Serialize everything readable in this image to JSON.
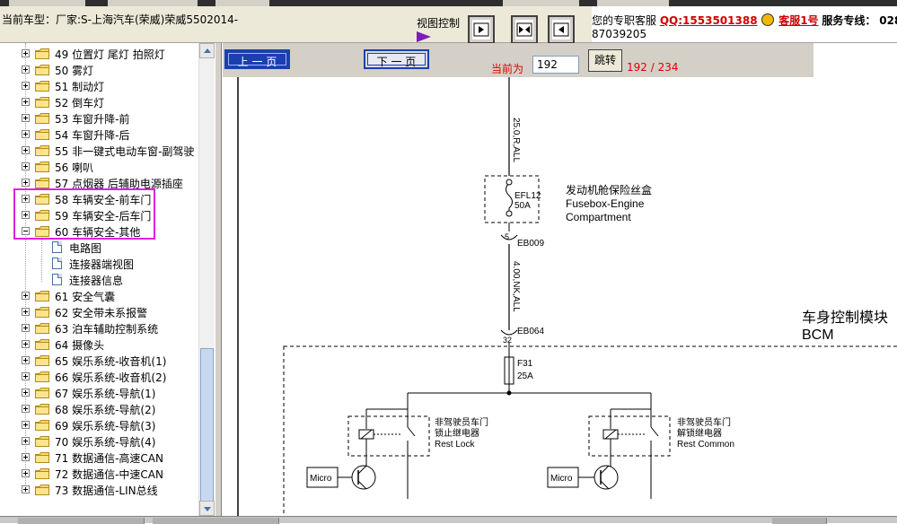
{
  "header": {
    "car_type": "当前车型：厂家:S-上海汽车(荣威)荣威5502014-",
    "view_control": "视图控制"
  },
  "service": {
    "prefix": "您的专职客服",
    "qq": "QQ:1553501388",
    "kefu": "客服1号",
    "hotline_label": "服务专线：",
    "hotline_number": "028",
    "hotline_rest": "87039205"
  },
  "tree": {
    "items": [
      {
        "label": "49 位置灯 尾灯 拍照灯",
        "expander": "plus"
      },
      {
        "label": "50 雾灯",
        "expander": "plus"
      },
      {
        "label": "51 制动灯",
        "expander": "plus"
      },
      {
        "label": "52 倒车灯",
        "expander": "plus"
      },
      {
        "label": "53 车窗升降-前",
        "expander": "plus"
      },
      {
        "label": "54 车窗升降-后",
        "expander": "plus"
      },
      {
        "label": "55 非一键式电动车窗-副驾驶",
        "expander": "plus"
      },
      {
        "label": "56 喇叭",
        "expander": "plus"
      },
      {
        "label": "57 点烟器 后辅助电源插座",
        "expander": "plus"
      },
      {
        "label": "58 车辆安全-前车门",
        "expander": "plus"
      },
      {
        "label": "59 车辆安全-后车门",
        "expander": "plus"
      },
      {
        "label": "60 车辆安全-其他",
        "expander": "minus"
      },
      {
        "label": "61 安全气囊",
        "expander": "plus"
      },
      {
        "label": "62 安全带未系报警",
        "expander": "plus"
      },
      {
        "label": "63 泊车辅助控制系统",
        "expander": "plus"
      },
      {
        "label": "64 摄像头",
        "expander": "plus"
      },
      {
        "label": "65 娱乐系统-收音机(1)",
        "expander": "plus"
      },
      {
        "label": "66 娱乐系统-收音机(2)",
        "expander": "plus"
      },
      {
        "label": "67 娱乐系统-导航(1)",
        "expander": "plus"
      },
      {
        "label": "68 娱乐系统-导航(2)",
        "expander": "plus"
      },
      {
        "label": "69 娱乐系统-导航(3)",
        "expander": "plus"
      },
      {
        "label": "70 娱乐系统-导航(4)",
        "expander": "plus"
      },
      {
        "label": "71 数据通信-高速CAN",
        "expander": "plus"
      },
      {
        "label": "72 数据通信-中速CAN",
        "expander": "plus"
      },
      {
        "label": "73 数据通信-LIN总线",
        "expander": "plus"
      }
    ],
    "subitems": [
      "电路图",
      "连接器端视图",
      "连接器信息"
    ]
  },
  "nav": {
    "prev": "上 一 页",
    "next": "下 一 页",
    "current_label": "当前为",
    "page_value": "192",
    "jump": "跳转",
    "page_count": "192 / 234"
  },
  "diagram": {
    "wire_top": "25.0,R,ALL",
    "fuse_name": "EFL12",
    "fuse_rating": "50A",
    "fusebox_cn": "发动机舱保险丝盒",
    "fusebox_en1": "Fusebox-Engine",
    "fusebox_en2": "Compartment",
    "pin5": "5",
    "eb009": "EB009",
    "wire_mid": "4.00,NK,ALL",
    "pin32": "32",
    "eb064": "EB064",
    "bcm_cn": "车身控制模块",
    "bcm_en": "BCM",
    "f31": "F31",
    "f31_rating": "25A",
    "relay1_cn1": "非驾驶员车门",
    "relay1_cn2": "锁止继电器",
    "relay1_en": "Rest Lock",
    "relay2_cn1": "非驾驶员车门",
    "relay2_cn2": "解锁继电器",
    "relay2_en": "Rest Common",
    "micro": "Micro"
  }
}
